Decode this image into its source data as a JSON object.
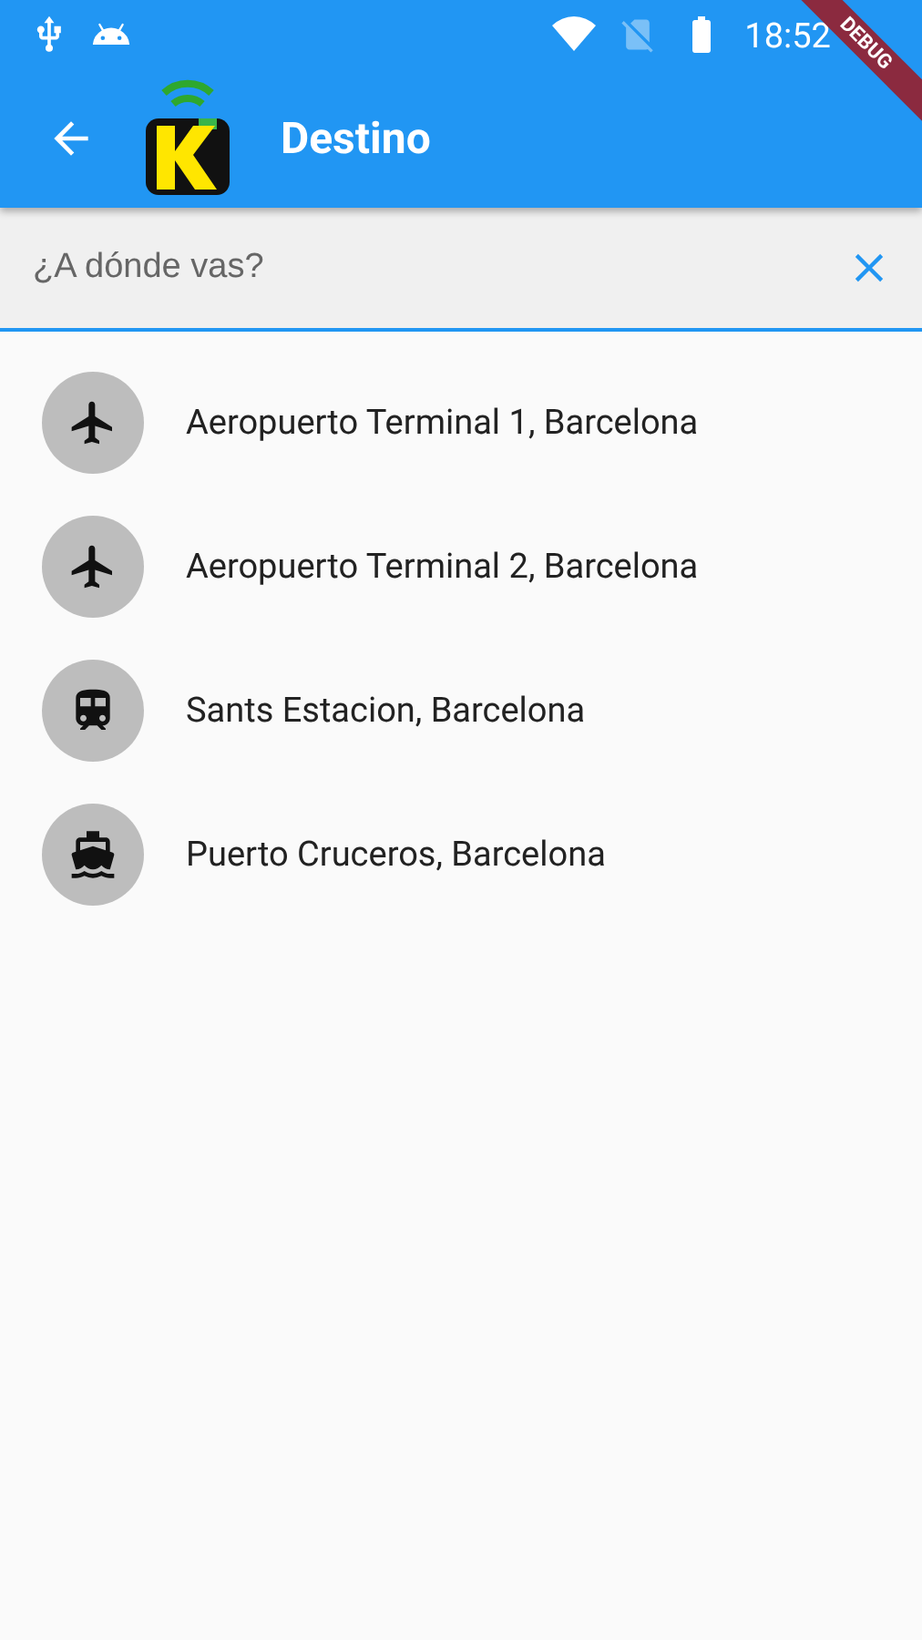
{
  "status_bar": {
    "time": "18:52"
  },
  "app_bar": {
    "title": "Destino"
  },
  "debug_banner": "DEBUG",
  "search": {
    "placeholder": "¿A dónde vas?"
  },
  "destinations": [
    {
      "kind": "airport",
      "name": "Aeropuerto Terminal 1, Barcelona"
    },
    {
      "kind": "airport",
      "name": "Aeropuerto Terminal 2, Barcelona"
    },
    {
      "kind": "train",
      "name": "Sants Estacion, Barcelona"
    },
    {
      "kind": "ship",
      "name": "Puerto Cruceros, Barcelona"
    }
  ]
}
